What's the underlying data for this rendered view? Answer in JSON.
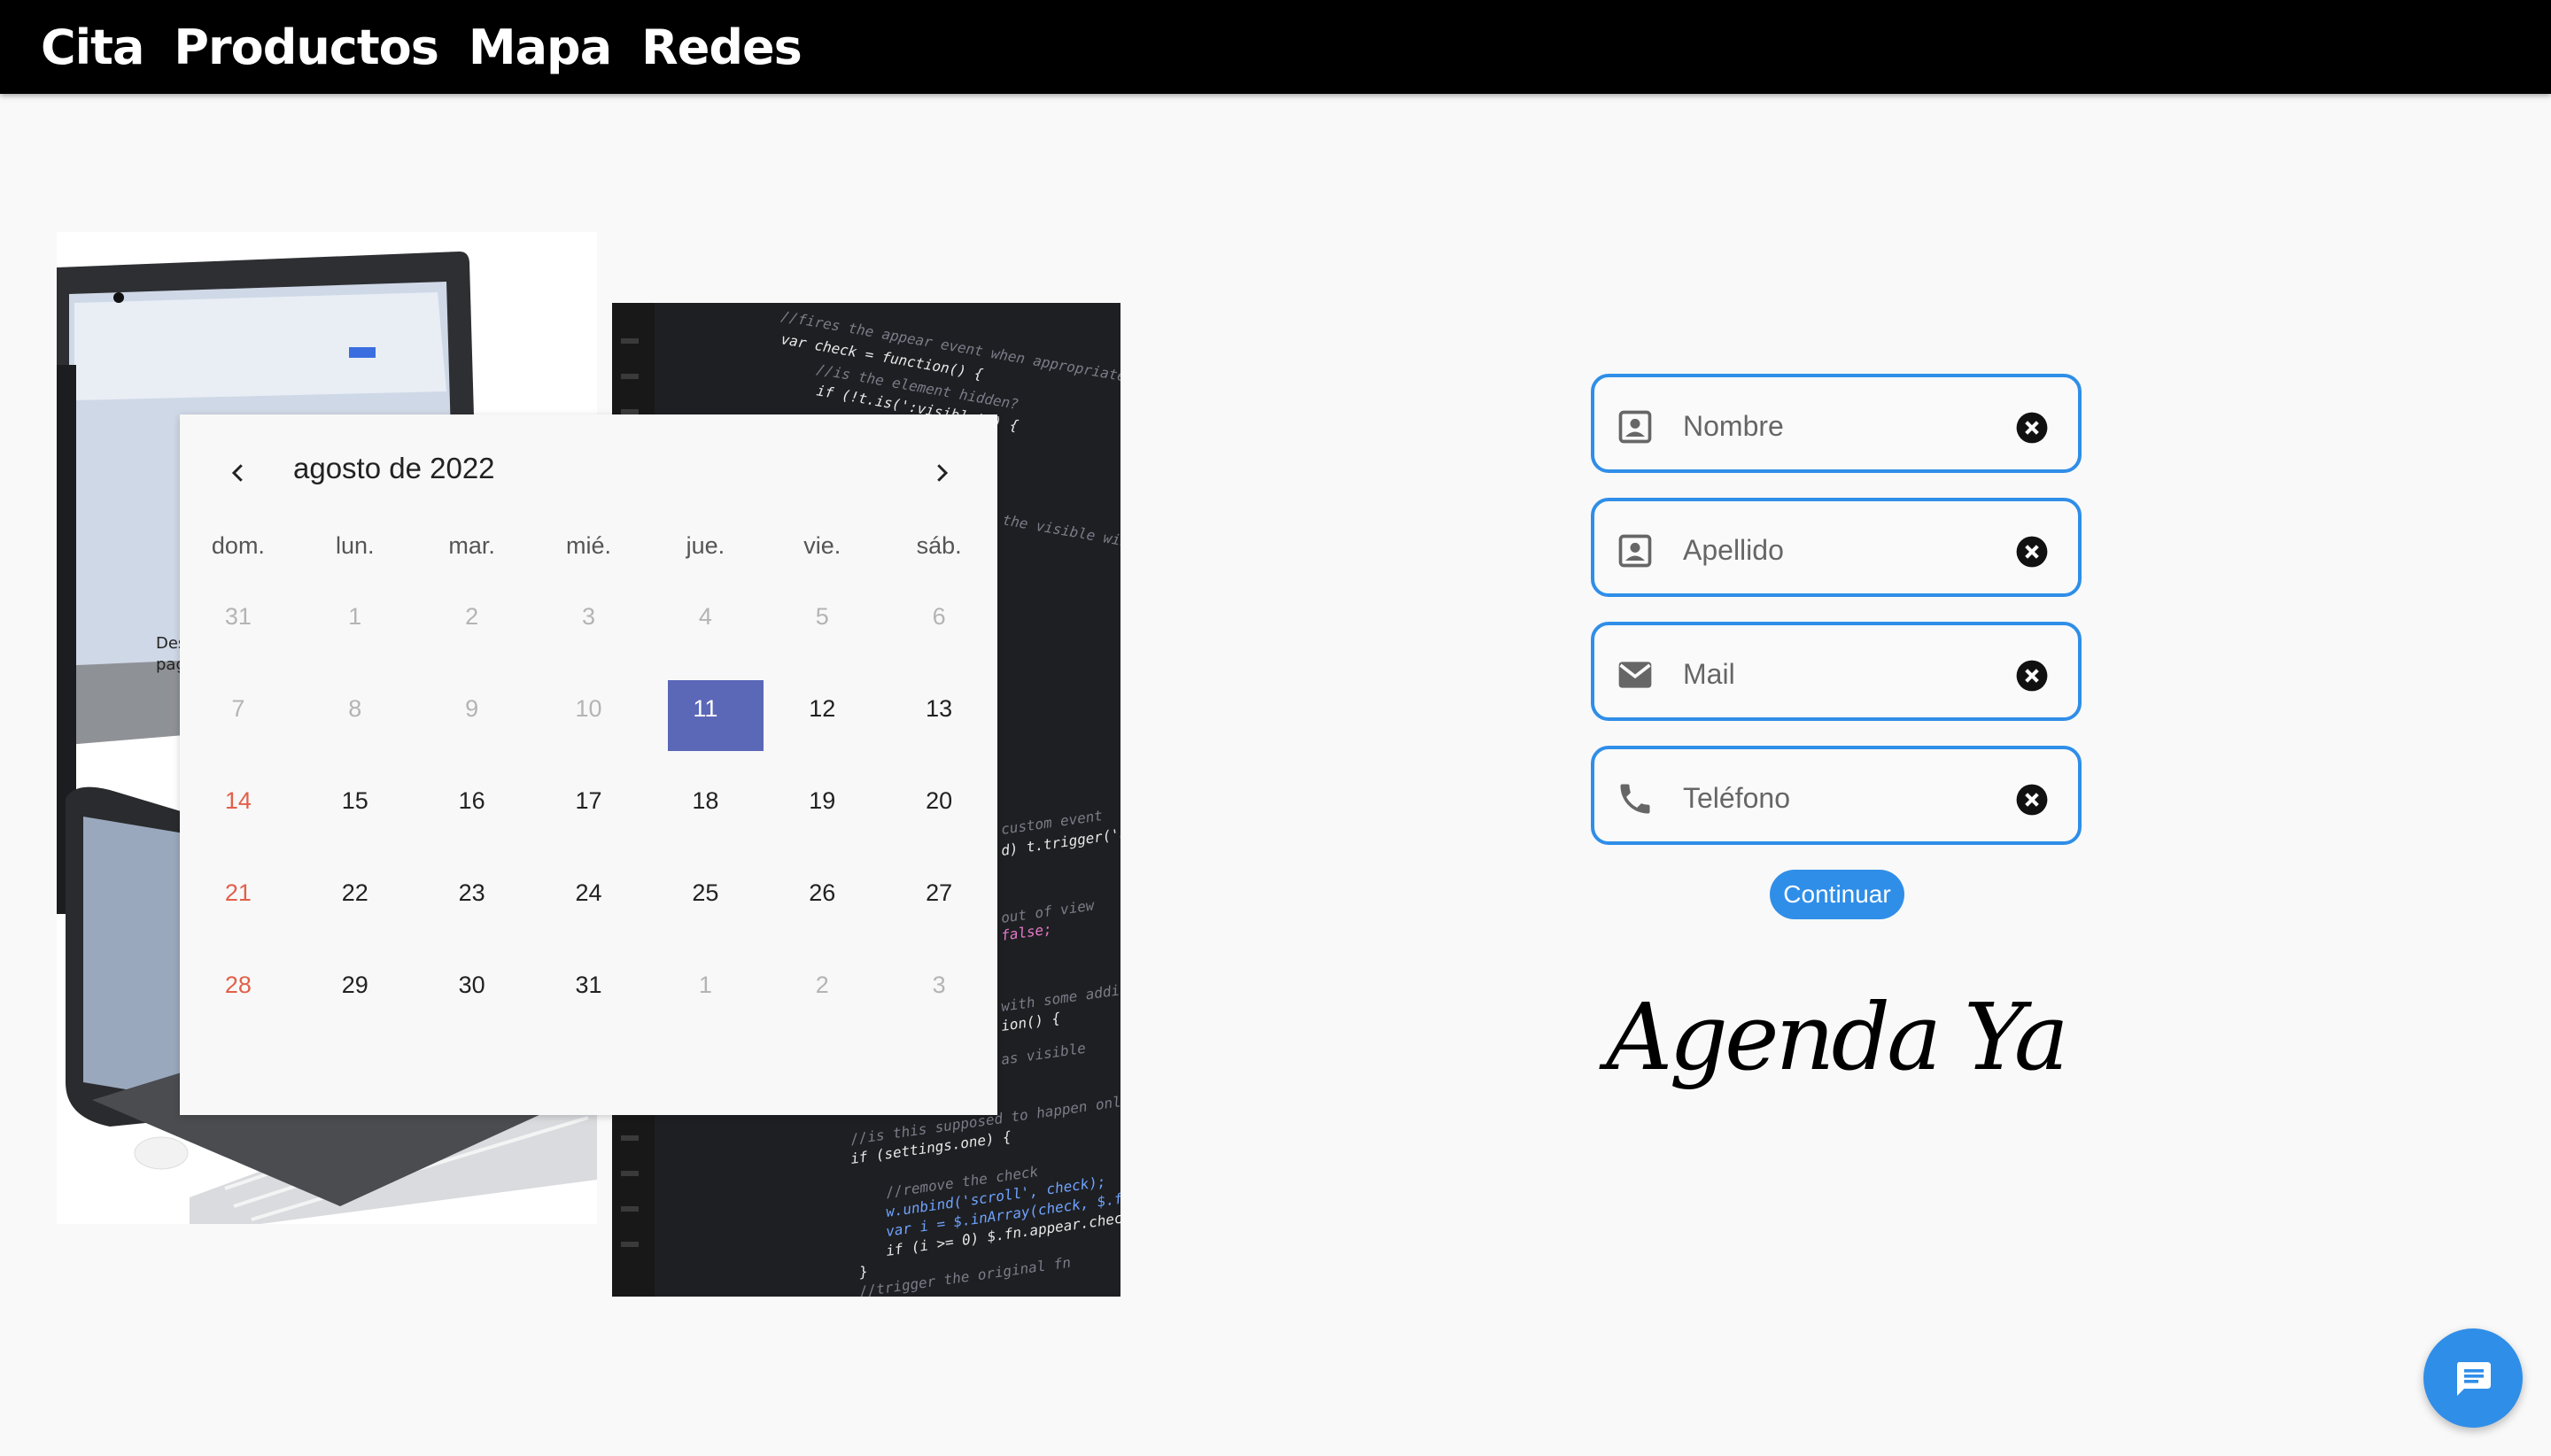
{
  "nav": {
    "items": [
      "Cita",
      "Productos",
      "Mapa",
      "Redes"
    ]
  },
  "calendar": {
    "month_label": "agosto de 2022",
    "weekdays": [
      "dom.",
      "lun.",
      "mar.",
      "mié.",
      "jue.",
      "vie.",
      "sáb."
    ],
    "weeks": [
      [
        "31",
        "1",
        "2",
        "3",
        "4",
        "5",
        "6"
      ],
      [
        "7",
        "8",
        "9",
        "10",
        "11",
        "12",
        "13"
      ],
      [
        "14",
        "15",
        "16",
        "17",
        "18",
        "19",
        "20"
      ],
      [
        "21",
        "22",
        "23",
        "24",
        "25",
        "26",
        "27"
      ],
      [
        "28",
        "29",
        "30",
        "31",
        "1",
        "2",
        "3"
      ]
    ],
    "selected_day": "11",
    "icons": {
      "prev": "chevron-left-icon",
      "next": "chevron-right-icon"
    }
  },
  "form": {
    "fields": [
      {
        "placeholder": "Nombre",
        "icon": "contact-card-icon",
        "value": ""
      },
      {
        "placeholder": "Apellido",
        "icon": "contact-card-icon",
        "value": ""
      },
      {
        "placeholder": "Mail",
        "icon": "mail-icon",
        "value": ""
      },
      {
        "placeholder": "Teléfono",
        "icon": "phone-icon",
        "value": ""
      }
    ],
    "continue_label": "Continuar"
  },
  "brand": {
    "tagline": "Agenda Ya"
  },
  "colors": {
    "topbar": "#000000",
    "accent": "#2f8ee8",
    "selected_day": "#5b68b8",
    "sunday": "#e2604a",
    "background": "#f9f9f9"
  },
  "chat": {
    "icon": "chat-icon"
  }
}
